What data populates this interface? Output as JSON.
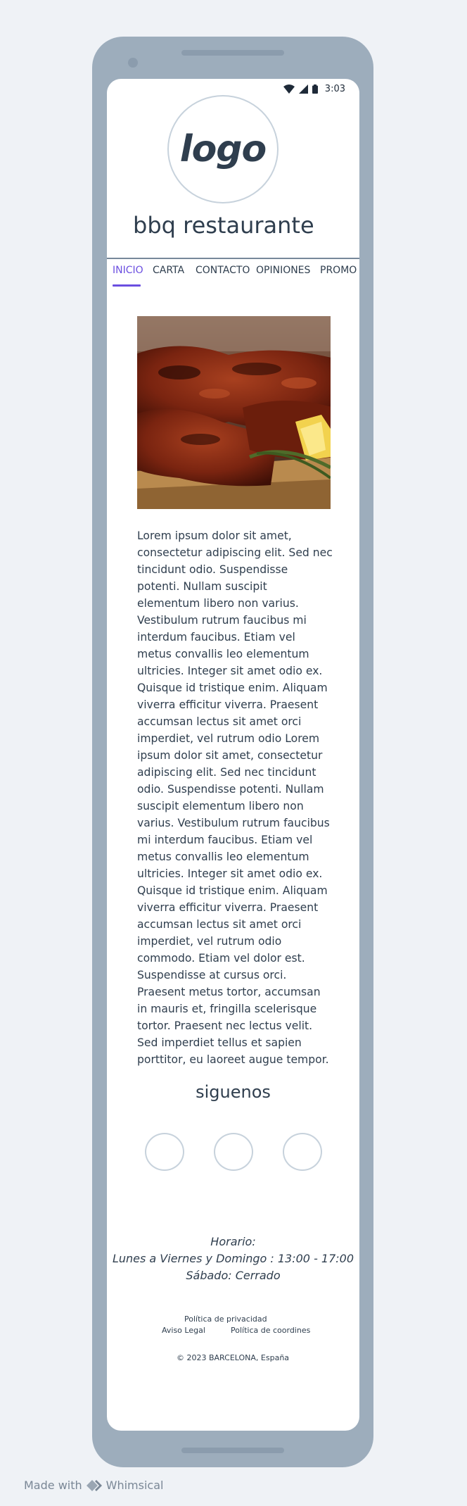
{
  "status_bar": {
    "time": "3:03",
    "icons": [
      "wifi-icon",
      "signal-icon",
      "battery-icon"
    ]
  },
  "header": {
    "logo_text": "logo",
    "restaurant_name": "bbq restaurante"
  },
  "nav": {
    "items": [
      {
        "label": "INICIO",
        "active": true
      },
      {
        "label": "CARTA",
        "active": false
      },
      {
        "label": "CONTACTO",
        "active": false
      },
      {
        "label": "OPINIONES",
        "active": false
      },
      {
        "label": "PROMO",
        "active": false
      }
    ],
    "accent_color": "#6b4fe0"
  },
  "main": {
    "image_subject": "barbecue ribs",
    "body_text": "Lorem ipsum dolor sit amet, consectetur adipiscing elit. Sed nec tincidunt odio. Suspendisse potenti. Nullam suscipit elementum libero non varius. Vestibulum rutrum faucibus mi interdum faucibus. Etiam vel metus convallis leo elementum ultricies. Integer sit amet odio ex. Quisque id tristique enim. Aliquam viverra efficitur viverra. Praesent accumsan lectus sit amet orci imperdiet, vel rutrum odio  Lorem ipsum dolor sit amet, consectetur adipiscing elit. Sed nec tincidunt odio. Suspendisse potenti. Nullam suscipit elementum libero non varius. Vestibulum rutrum faucibus mi interdum faucibus. Etiam vel metus convallis leo elementum ultricies. Integer sit amet odio ex. Quisque id tristique enim. Aliquam viverra efficitur viverra. Praesent accumsan lectus sit amet orci imperdiet, vel rutrum odio commodo. Etiam vel dolor est. Suspendisse at cursus orci. Praesent metus tortor, accumsan in mauris et, fringilla scelerisque tortor. Praesent nec lectus velit. Sed imperdiet tellus et sapien porttitor, eu laoreet augue tempor."
  },
  "social": {
    "title": "siguenos"
  },
  "footer": {
    "hours_title": "Horario:",
    "hours_weekdays": "Lunes a Viernes y Domingo : 13:00 - 17:00",
    "hours_saturday": "Sábado: Cerrado",
    "privacy_link": "Política de privacidad",
    "legal_link": "Aviso Legal",
    "cookies_link": "Política de coordines",
    "copyright": "© 2023 BARCELONA, España"
  },
  "watermark": {
    "made_with": "Made with",
    "brand": "Whimsical"
  }
}
